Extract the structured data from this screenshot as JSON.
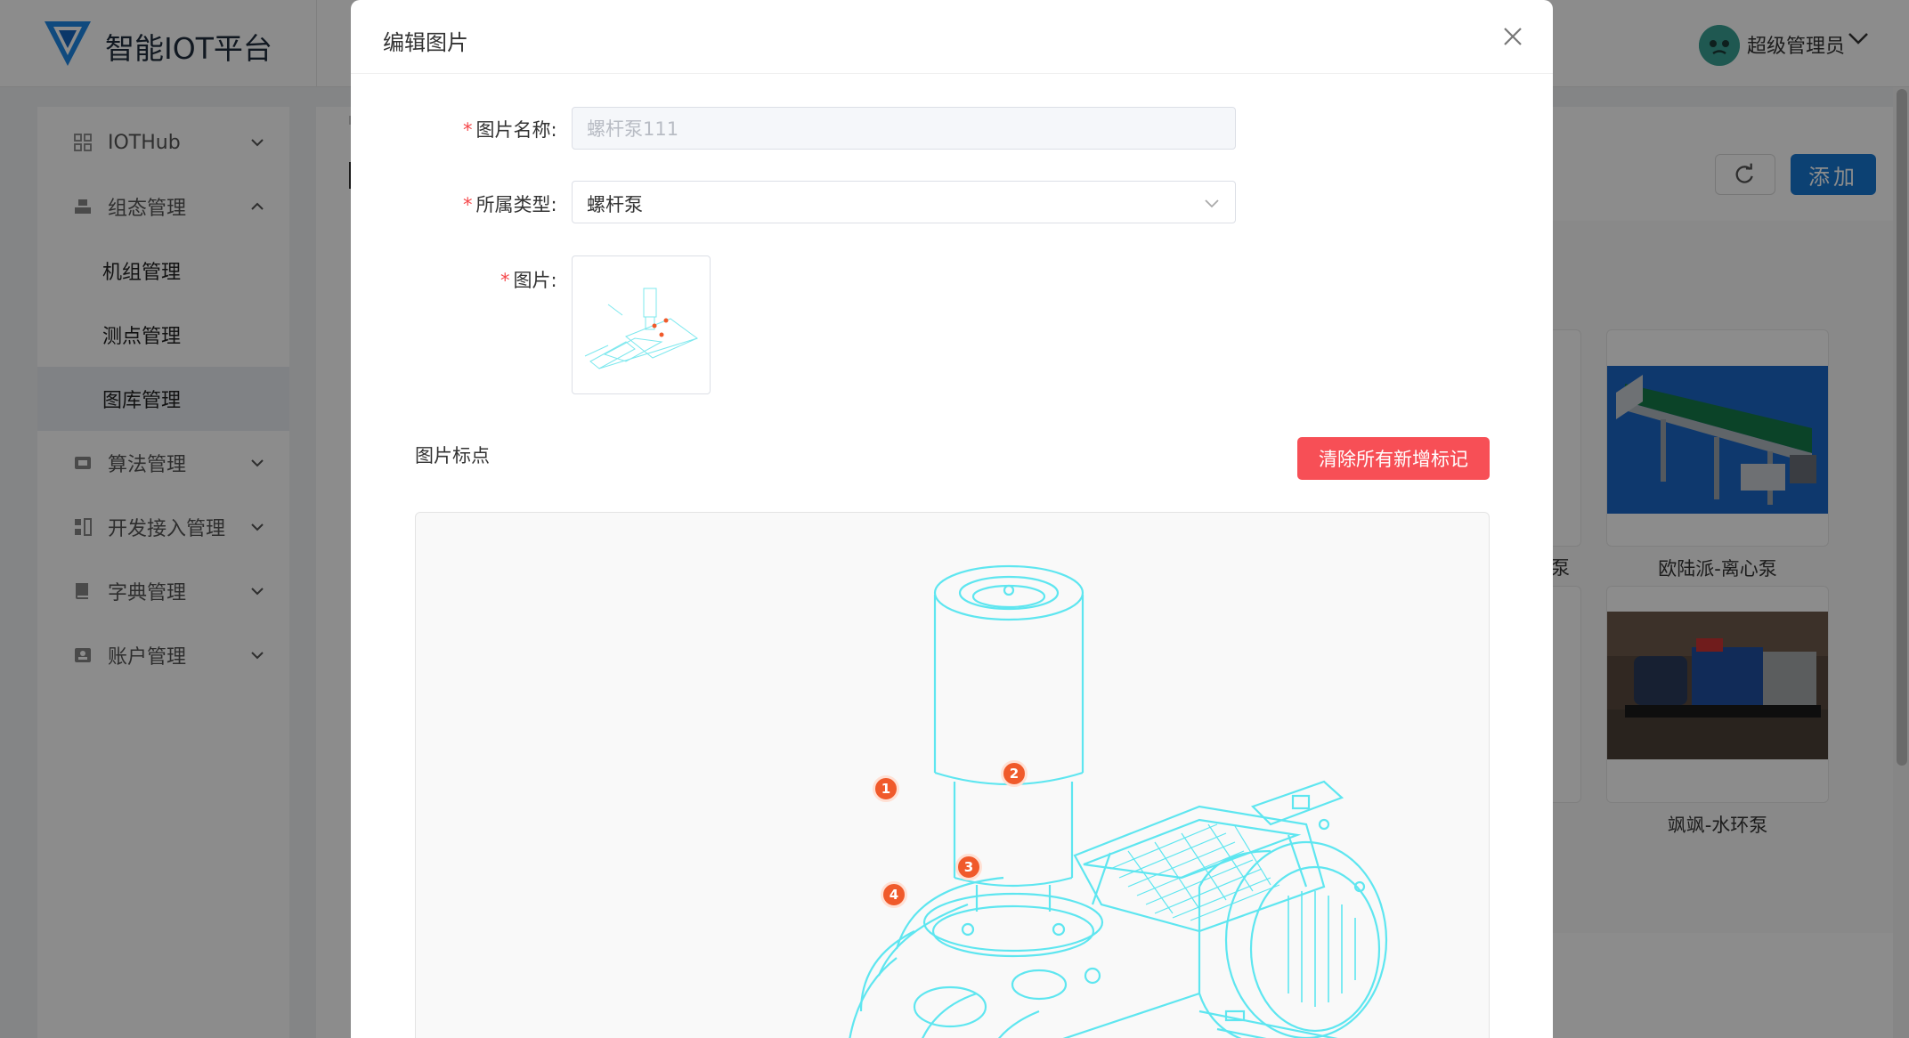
{
  "app": {
    "brand": "智能IOT平台",
    "user_name": "超级管理员"
  },
  "sidebar": {
    "items": [
      {
        "label": "IOTHub",
        "icon": "grid-icon"
      },
      {
        "label": "组态管理",
        "icon": "layers-icon"
      },
      {
        "label": "机组管理"
      },
      {
        "label": "测点管理"
      },
      {
        "label": "图库管理"
      },
      {
        "label": "算法管理",
        "icon": "chip-icon"
      },
      {
        "label": "开发接入管理",
        "icon": "plug-icon"
      },
      {
        "label": "字典管理",
        "icon": "book-icon"
      },
      {
        "label": "账户管理",
        "icon": "user-card-icon"
      }
    ]
  },
  "toolbar": {
    "add_label": "添加"
  },
  "gallery": {
    "cards": [
      {
        "label": "欧陆派-离心泵"
      },
      {
        "label": "飒飒-水环泵"
      }
    ],
    "partial_label": "泵"
  },
  "modal": {
    "title": "编辑图片",
    "fields": {
      "name_label": "图片名称:",
      "name_value": "螺杆泵111",
      "type_label": "所属类型:",
      "type_value": "螺杆泵",
      "image_label": "图片:"
    },
    "markers_section": "图片标点",
    "clear_button": "清除所有新增标记",
    "markers": [
      "1",
      "2",
      "3",
      "4"
    ]
  },
  "colors": {
    "primary": "#1677d2",
    "danger": "#f74f56",
    "required": "#f5484b",
    "line_art": "#5ee6f0",
    "marker": "#f05a2b"
  }
}
